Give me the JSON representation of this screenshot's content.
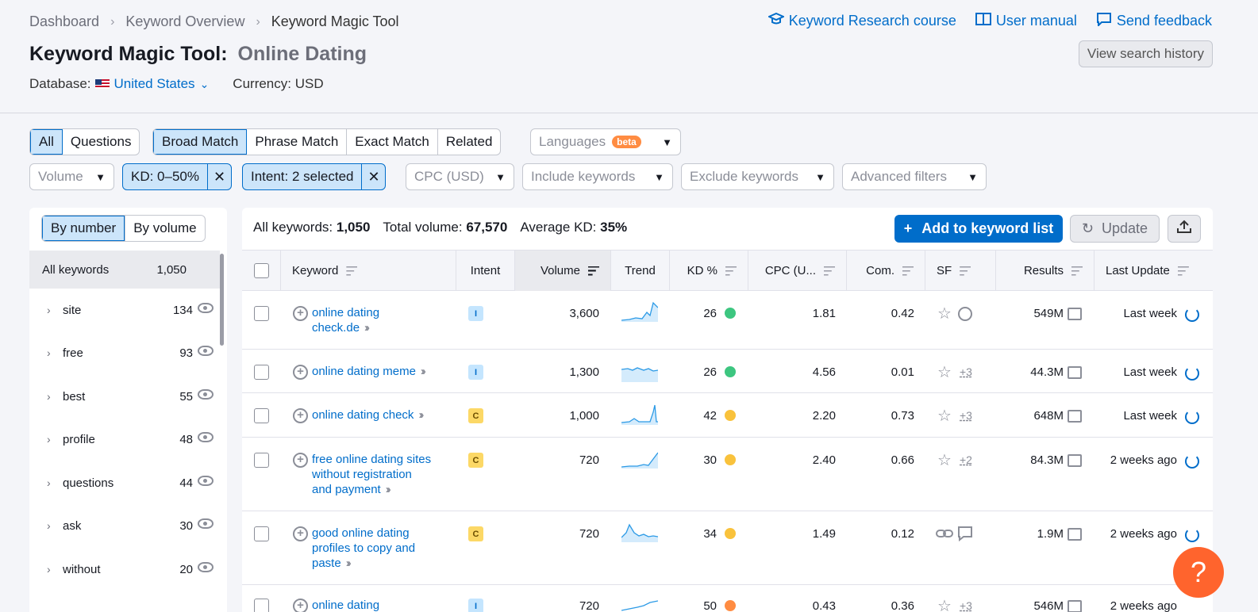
{
  "breadcrumb": [
    "Dashboard",
    "Keyword Overview",
    "Keyword Magic Tool"
  ],
  "top_links": [
    "Keyword Research course",
    "User manual",
    "Send feedback"
  ],
  "title": "Keyword Magic Tool:",
  "query": "Online Dating",
  "history_button": "View search history",
  "database_label": "Database:",
  "database_value": "United States",
  "currency": "Currency: USD",
  "tabs_type": [
    "All",
    "Questions"
  ],
  "tabs_match": [
    "Broad Match",
    "Phrase Match",
    "Exact Match",
    "Related"
  ],
  "languages": {
    "label": "Languages",
    "badge": "beta"
  },
  "filters": {
    "volume": "Volume",
    "kd_chip": "KD: 0–50%",
    "intent_chip": "Intent: 2 selected",
    "cpc": "CPC (USD)",
    "include": "Include keywords",
    "exclude": "Exclude keywords",
    "advanced": "Advanced filters"
  },
  "left_toggle": [
    "By number",
    "By volume"
  ],
  "all_keywords": {
    "label": "All keywords",
    "count": "1,050"
  },
  "groups": [
    {
      "name": "site",
      "count": "134"
    },
    {
      "name": "free",
      "count": "93"
    },
    {
      "name": "best",
      "count": "55"
    },
    {
      "name": "profile",
      "count": "48"
    },
    {
      "name": "questions",
      "count": "44"
    },
    {
      "name": "ask",
      "count": "30"
    },
    {
      "name": "without",
      "count": "20"
    }
  ],
  "summary": {
    "all_label": "All keywords:",
    "all_value": "1,050",
    "vol_label": "Total volume:",
    "vol_value": "67,570",
    "kd_label": "Average KD:",
    "kd_value": "35%"
  },
  "buttons": {
    "add": "Add to keyword list",
    "update": "Update"
  },
  "columns": [
    "Keyword",
    "Intent",
    "Volume",
    "Trend",
    "KD %",
    "CPC (U...",
    "Com.",
    "SF",
    "Results",
    "Last Update"
  ],
  "rows": [
    {
      "kw": [
        "online dating",
        "check.de"
      ],
      "intent": "I",
      "volume": "3,600",
      "kd": "26",
      "kd_color": "#3dc680",
      "cpc": "1.81",
      "com": "0.42",
      "sf_more": "",
      "results": "549M",
      "updated": "Last week"
    },
    {
      "kw": [
        "online dating meme"
      ],
      "intent": "I",
      "volume": "1,300",
      "kd": "26",
      "kd_color": "#3dc680",
      "cpc": "4.56",
      "com": "0.01",
      "sf_more": "+3",
      "results": "44.3M",
      "updated": "Last week"
    },
    {
      "kw": [
        "online dating check"
      ],
      "intent": "C",
      "volume": "1,000",
      "kd": "42",
      "kd_color": "#f9c23c",
      "cpc": "2.20",
      "com": "0.73",
      "sf_more": "+3",
      "results": "648M",
      "updated": "Last week"
    },
    {
      "kw": [
        "free online dating sites",
        "without registration",
        "and payment"
      ],
      "intent": "C",
      "volume": "720",
      "kd": "30",
      "kd_color": "#f9c23c",
      "cpc": "2.40",
      "com": "0.66",
      "sf_more": "+2",
      "results": "84.3M",
      "updated": "2 weeks ago"
    },
    {
      "kw": [
        "good online dating",
        "profiles to copy and",
        "paste"
      ],
      "intent": "C",
      "volume": "720",
      "kd": "34",
      "kd_color": "#f9c23c",
      "cpc": "1.49",
      "com": "0.12",
      "sf_more": "",
      "results": "1.9M",
      "updated": "2 weeks ago"
    },
    {
      "kw": [
        "online dating"
      ],
      "intent": "I",
      "volume": "720",
      "kd": "50",
      "kd_color": "#ff8c42",
      "cpc": "0.43",
      "com": "0.36",
      "sf_more": "+3",
      "results": "546M",
      "updated": "2 weeks ago"
    }
  ],
  "help": "?"
}
